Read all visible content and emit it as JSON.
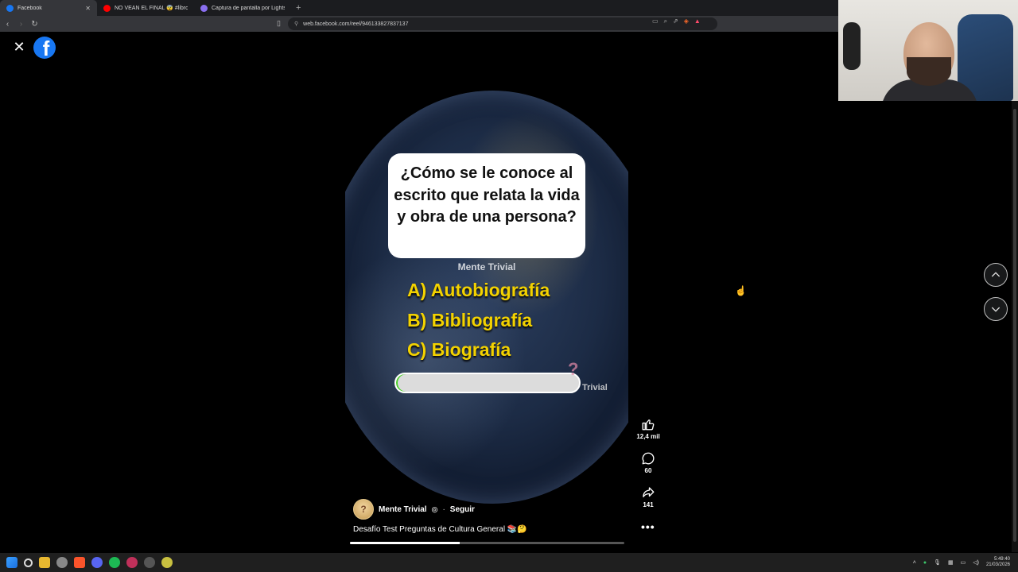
{
  "browser": {
    "tabs": [
      {
        "title": "Facebook",
        "favicon_color": "#1877f2",
        "active": true
      },
      {
        "title": "NO VEAN EL FINAL 😨 #libros #fisica",
        "favicon_color": "#ff0000",
        "active": false
      },
      {
        "title": "Captura de pantalla por Lightshot",
        "favicon_color": "#8a6ff0",
        "active": false
      }
    ],
    "new_tab_glyph": "+",
    "close_tab_glyph": "✕",
    "url": "web.facebook.com/reel/946133827837137"
  },
  "reel": {
    "close_glyph": "✕",
    "logo_letter": "f",
    "question": "¿Cómo se le conoce al escrito que relata la vida y obra de una persona?",
    "brand": "Mente Trivial",
    "options": [
      "A) Autobiografía",
      "B) Bibliografía",
      "C) Biografía"
    ],
    "watermark_glyph": "?",
    "watermark_text": "Trivial",
    "author": "Mente Trivial",
    "follow": "Seguir",
    "caption": "Desafío Test Preguntas de Cultura General 📚🤔",
    "progress": 0.4,
    "likes": "12,4 mil",
    "comments": "60",
    "shares": "141",
    "more_glyph": "•••"
  },
  "icons": {
    "like": "thumbs-up-icon",
    "comment": "comment-icon",
    "share": "share-icon",
    "up": "chevron-up-icon",
    "down": "chevron-down-icon"
  },
  "colors": {
    "facebook_blue": "#1877f2",
    "option_yellow": "#f3d200"
  },
  "taskbar": {
    "time": "5:49:40",
    "date": "21/03/2026"
  }
}
